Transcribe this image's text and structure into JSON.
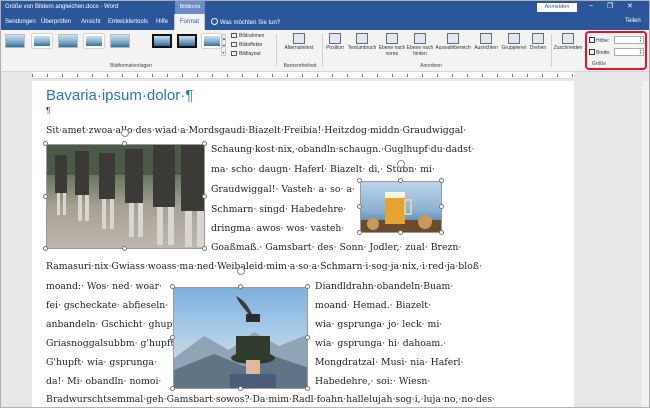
{
  "window": {
    "title": "Größe von Bildern angleichen.docx  -  Word",
    "context_tab": "Bildtools",
    "signin_label": "Anmelden",
    "minimize": "–",
    "restore": "❐",
    "close": "✕"
  },
  "tabs": [
    "Sendungen",
    "Überprüfen",
    "Ansicht",
    "Entwicklertools",
    "Hilfe",
    "Format"
  ],
  "active_tab": "Format",
  "tellme": "Was möchten Sie tun?",
  "share_label": "Teilen",
  "ribbon": {
    "gallery_scroll": [
      "▲",
      "▼",
      "▾"
    ],
    "picture_border": "Bildrahmen",
    "picture_effects": "Bildeffekte",
    "picture_layout": "Bildlayout",
    "styles_group": "Bildformatvorlagen",
    "alt_text": "Alternativtext",
    "accessibility_group": "Barrierefreiheit",
    "position": "Position",
    "wrap_text": "Textumbruch",
    "bring_forward": "Ebene nach vorne",
    "send_backward": "Ebene nach hinten",
    "selection_pane": "Auswahlbereich",
    "align": "Ausrichten",
    "group": "Gruppieren",
    "rotate": "Drehen",
    "arrange_group": "Anordnen",
    "crop": "Zuschneiden",
    "height_label": "Höhe:",
    "width_label": "Breite:",
    "size_group": "Größe",
    "height_value": "",
    "width_value": ""
  },
  "document": {
    "heading": "Bavaria·ipsum·dolor·¶",
    "empty_paragraph": "¶",
    "lines": [
      "Sit·amet·zwoa·allo·des·wiad·a·Mordsgaudi·Biazelt·Freibia!·Heitzdog·middn·Graudwiggal·",
      "Schaung·kost·nix,·obandln·schaugn.·Guglhupf·du·dadst·",
      "ma·  scho·  daugn·  Haferl·  Biazelt·  di,·  Stubn·  mi·",
      "Graudwiggal!·  Vasteh·  a·  so·  a·",
      "Schmarn·  singd·  Habedehre·",
      "dringma·  awos·  wos·  vasteh·",
      "Goaßmaß.·  Gamsbart·  des·  Sonn·  Jodler,·  zual·  Brezn·",
      "Ramasuri·nix·Gwiass·woass·ma·ned·Weibaleid·mim·a·so·a·Schmarn·i·sog·ja·nix,·i·red·ja·bloß·",
      "moand:·  Wos·  ned·  woar·",
      "Diandldrahn·obandeln·Buam·",
      "fei·  gscheckate·  abfieseln·",
      "moand·  Hemad.·  Biazelt·",
      "anbandeln·  Gschicht·  ghupft·",
      "wia·  gsprunga·  jo·  leck·  mi·",
      "Griasnoggalsubbm·  g'hupft·",
      "wia·  gsprunga·  hi·  dahoam.·",
      "G'hupft·  wia·  gsprunga·",
      "Mongdratzal·  Musi·  nia·  Haferl·",
      "da!·  Mi·  obandln·  nomoi·",
      "Habedehre,·  soi:·  Wiesn·",
      "Bradwurschtsemmal·geh·Gamsbart·sowos?·Da·mim·Radl·foahn·hallelujah·sog·i,·luja·no,·no·des·"
    ]
  },
  "colors": {
    "title_bar": "#2b579a",
    "heading": "#2e74b5",
    "size_highlight": "#e81123"
  }
}
